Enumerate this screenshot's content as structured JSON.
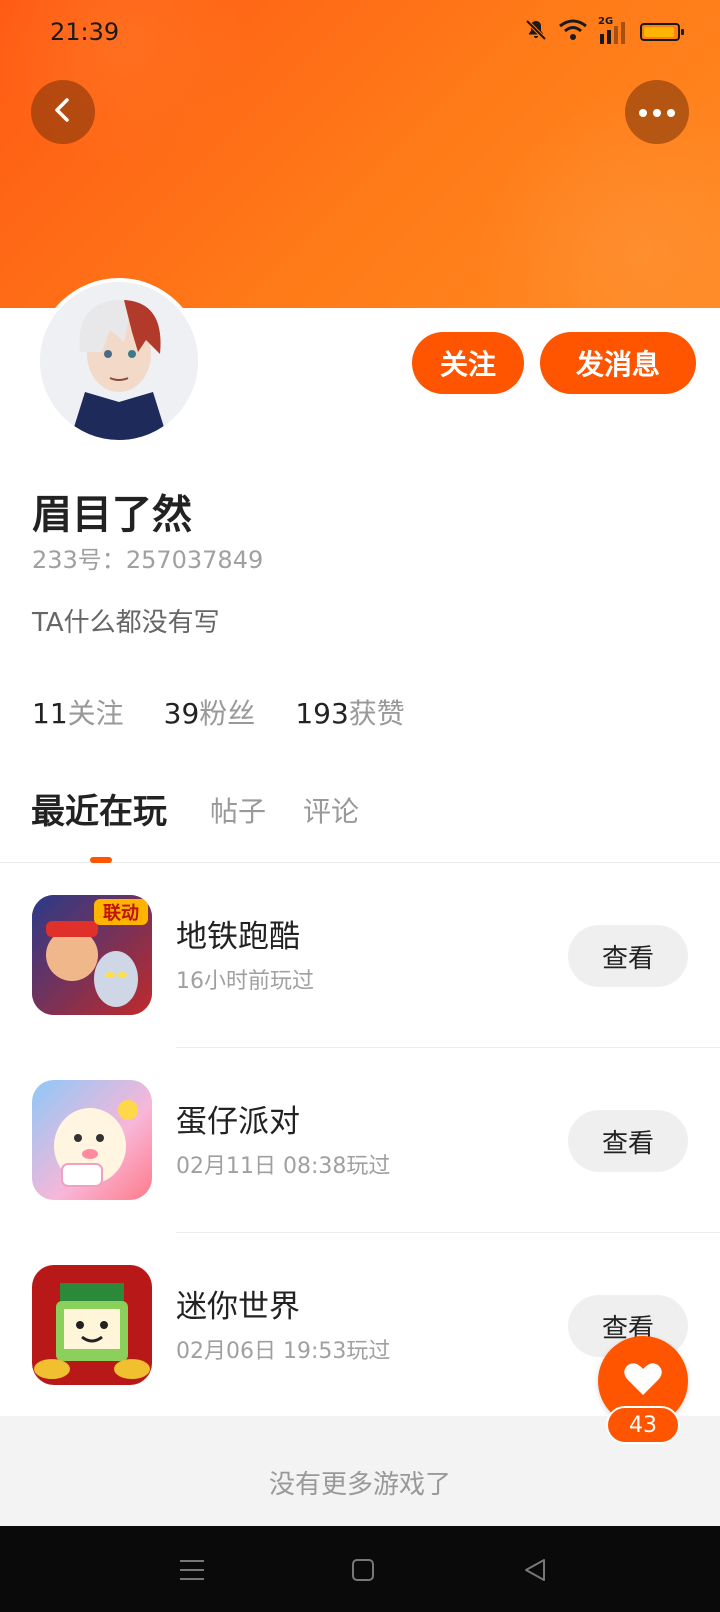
{
  "status_bar": {
    "time": "21:39",
    "network_label": "2G",
    "icons": [
      "mute-bell-icon",
      "wifi-icon",
      "cellular-signal-icon",
      "battery-icon"
    ]
  },
  "header": {
    "back_icon": "chevron-left-icon",
    "more_icon": "ellipsis-icon",
    "accent_color": "#ff5500"
  },
  "profile": {
    "name": "眉目了然",
    "uid_label": "233号：",
    "uid_value": "257037849",
    "bio": "TA什么都没有写",
    "follow_label": "关注",
    "message_label": "发消息",
    "stats": [
      {
        "value": "11",
        "label": "关注"
      },
      {
        "value": "39",
        "label": "粉丝"
      },
      {
        "value": "193",
        "label": "获赞"
      }
    ]
  },
  "tabs": [
    {
      "label": "最近在玩",
      "active": true
    },
    {
      "label": "帖子",
      "active": false
    },
    {
      "label": "评论",
      "active": false
    }
  ],
  "games": [
    {
      "name": "地铁跑酷",
      "time": "16小时前玩过",
      "button": "查看",
      "icon_badge": "联动"
    },
    {
      "name": "蛋仔派对",
      "time": "02月11日 08:38玩过",
      "button": "查看"
    },
    {
      "name": "迷你世界",
      "time": "02月06日 19:53玩过",
      "button": "查看"
    }
  ],
  "footer_text": "没有更多游戏了",
  "like": {
    "count": "43",
    "icon": "heart-icon"
  },
  "nav_bar": {
    "icons": [
      "menu-icon",
      "home-square-icon",
      "back-triangle-icon"
    ]
  }
}
